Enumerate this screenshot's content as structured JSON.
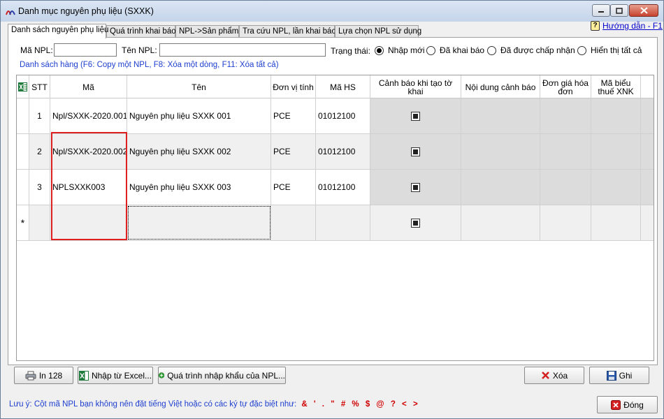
{
  "window": {
    "title": "Danh mục nguyên phụ liệu (SXXK)"
  },
  "tabs": [
    {
      "label": "Danh sách nguyên phụ liệu"
    },
    {
      "label": "Quá trình khai báo"
    },
    {
      "label": "NPL->Sản phẩm"
    },
    {
      "label": "Tra cứu NPL, lần khai báo"
    },
    {
      "label": "Lựa chọn NPL sử dụng"
    }
  ],
  "help": {
    "label": "Hướng dẫn - F1",
    "icon": "help-icon"
  },
  "filters": {
    "ma_npl_label": "Mã NPL:",
    "ma_npl_value": "",
    "ten_npl_label": "Tên NPL:",
    "ten_npl_value": "",
    "status_label": "Trạng thái:",
    "status_options": [
      "Nhập mới",
      "Đã khai báo",
      "Đã được chấp nhận",
      "Hiển thị tất cả"
    ],
    "status_selected": "Nhập mới"
  },
  "grid": {
    "caption": "Danh sách hàng (F6: Copy một NPL, F8: Xóa một dòng, F11: Xóa tất cả)",
    "excel_icon": "excel-icon",
    "columns": [
      "STT",
      "Mã",
      "Tên",
      "Đơn vị tính",
      "Mã HS",
      "Cảnh báo khi tạo tờ khai",
      "Nội dung cảnh báo",
      "Đơn giá hóa đơn",
      "Mã biểu thuế XNK"
    ],
    "rows": [
      {
        "stt": "1",
        "ma": "Npl/SXXK-2020.001",
        "ten": "Nguyên phụ liệu SXXK 001",
        "dvt": "PCE",
        "ma_hs": "01012100",
        "canh_bao": true
      },
      {
        "stt": "2",
        "ma": "Npl/SXXK-2020.002",
        "ten": "Nguyên phụ liệu SXXK 002",
        "dvt": "PCE",
        "ma_hs": "01012100",
        "canh_bao": true
      },
      {
        "stt": "3",
        "ma": "NPLSXXK003",
        "ten": "Nguyên phụ liệu SXXK 003",
        "dvt": "PCE",
        "ma_hs": "01012100",
        "canh_bao": true
      }
    ],
    "new_row_marker": "*",
    "highlight_color": "#e02020"
  },
  "buttons": {
    "print": "In 128",
    "import_excel": "Nhập từ Excel...",
    "import_process": "Quá trình nhập khẩu của NPL...",
    "delete": "Xóa",
    "save": "Ghi",
    "close": "Đóng"
  },
  "note": {
    "text": "Lưu ý: Cột mã NPL bạn không nên đặt tiếng Việt hoặc có các ký tự đặc biệt như:",
    "chars": "& ' . \" # % $ @ ? < >"
  }
}
